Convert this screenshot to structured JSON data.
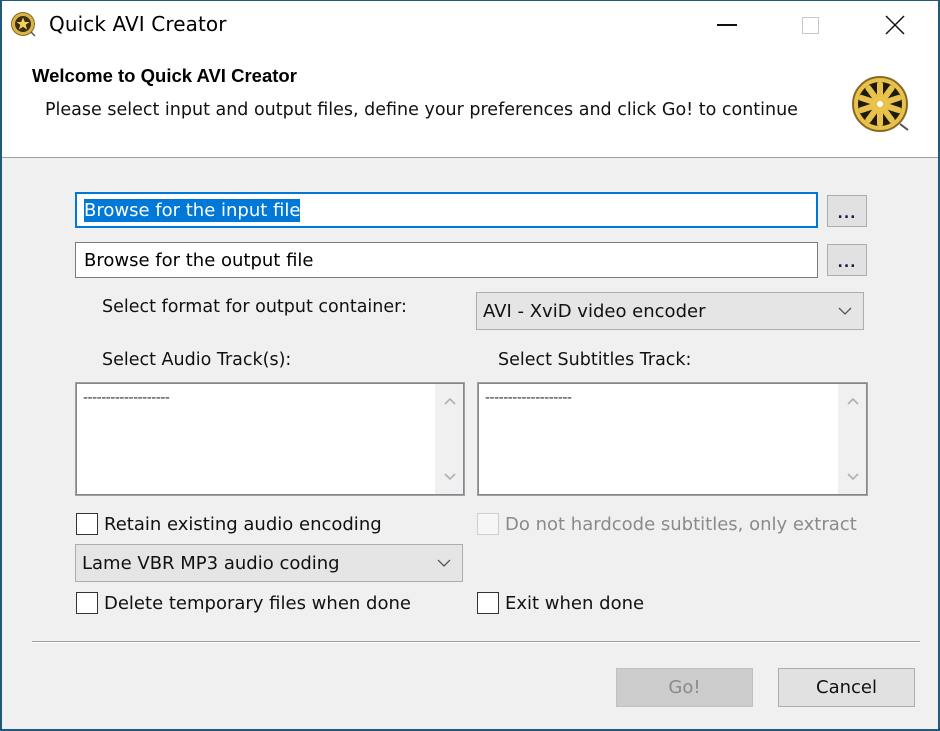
{
  "window": {
    "title": "Quick AVI Creator",
    "controls": {
      "minimize": "minimize",
      "maximize": "maximize",
      "close": "close"
    }
  },
  "header": {
    "title": "Welcome to Quick AVI Creator",
    "subtitle": "Please select input and output files, define your preferences and click Go! to continue",
    "icon": "film-reel-icon"
  },
  "inputs": {
    "input_file": {
      "value": "Browse for the input file",
      "selected": true,
      "browse_label": "..."
    },
    "output_file": {
      "value": "Browse for the output file",
      "browse_label": "..."
    }
  },
  "format": {
    "label": "Select format for output container:",
    "selected": "AVI - XviD video encoder"
  },
  "audio_tracks": {
    "label": "Select Audio Track(s):",
    "items": [
      "-------------------"
    ]
  },
  "subtitle_tracks": {
    "label": "Select Subtitles Track:",
    "items": [
      "-------------------"
    ]
  },
  "options": {
    "retain_audio": {
      "label": "Retain existing audio encoding",
      "checked": false
    },
    "no_hardcode_subs": {
      "label": "Do not hardcode subtitles, only extract",
      "checked": false,
      "disabled": true
    },
    "audio_codec": {
      "selected": "Lame VBR MP3 audio coding"
    },
    "delete_temp": {
      "label": "Delete temporary files when done",
      "checked": false
    },
    "exit_when_done": {
      "label": "Exit when done",
      "checked": false
    }
  },
  "buttons": {
    "go": {
      "label": "Go!",
      "disabled": true
    },
    "cancel": {
      "label": "Cancel"
    }
  },
  "colors": {
    "accent": "#0078d7",
    "window_border": "#1f5a7a",
    "reel_gold": "#e8c24a"
  }
}
